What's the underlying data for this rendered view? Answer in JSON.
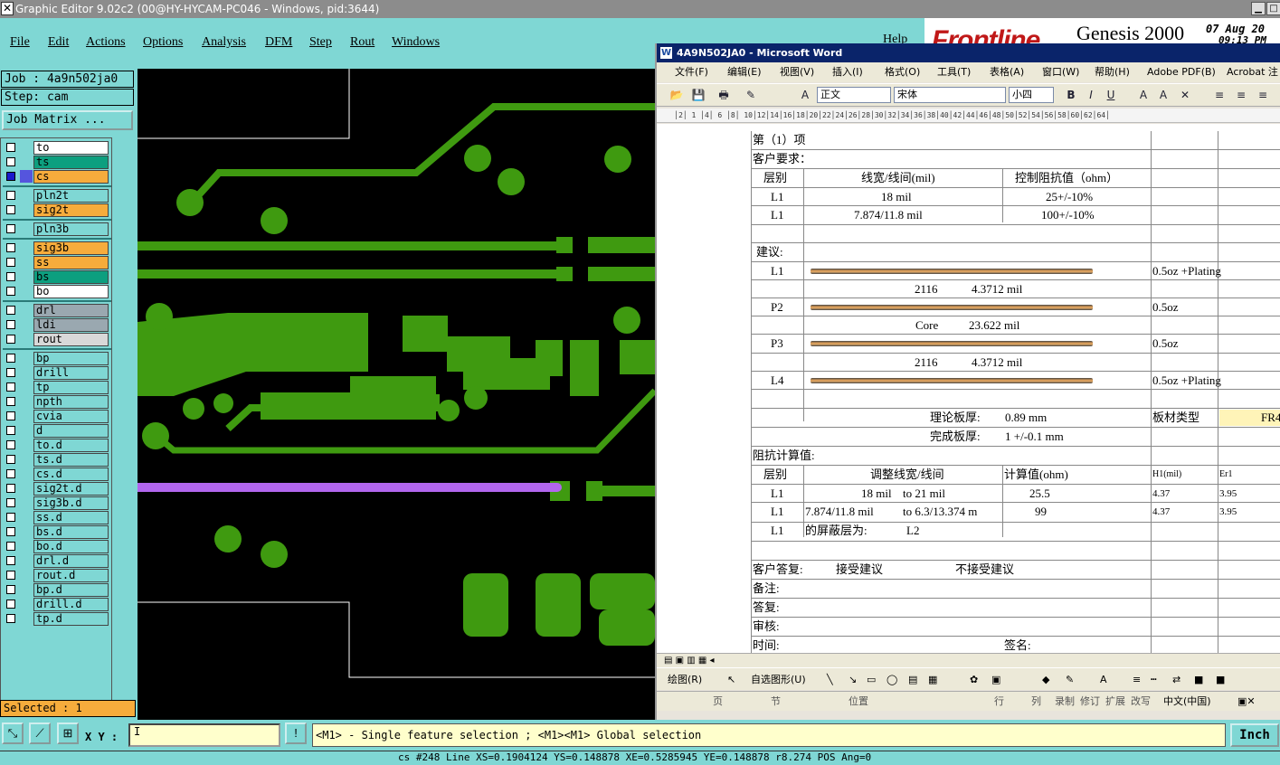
{
  "genesis": {
    "title": "Graphic Editor 9.02c2 (00@HY-HYCAM-PC046 - Windows, pid:3644)",
    "menu": [
      "File",
      "Edit",
      "Actions",
      "Options",
      "Analysis",
      "DFM",
      "Step",
      "Rout",
      "Windows"
    ],
    "help": "Help",
    "logo": {
      "brand": "Frontline",
      "product": "Genesis 2000",
      "date": "07 Aug 20",
      "time": "09:13 PM"
    },
    "job": "Job : 4a9n502ja0",
    "step": "Step: cam",
    "job_matrix": "Job Matrix ...",
    "layers": [
      {
        "name": "to",
        "color": "#ffffff"
      },
      {
        "name": "ts",
        "color": "#0d9f7f"
      },
      {
        "name": "cs",
        "color": "#f6ac3c",
        "selected": true
      },
      {
        "name": "pln2t",
        "color": "#7fd7d4"
      },
      {
        "name": "sig2t",
        "color": "#f6ac3c"
      },
      {
        "name": "pln3b",
        "color": "#7fd7d4"
      },
      {
        "name": "sig3b",
        "color": "#f6ac3c"
      },
      {
        "name": "ss",
        "color": "#f6ac3c"
      },
      {
        "name": "bs",
        "color": "#0d9f7f"
      },
      {
        "name": "bo",
        "color": "#ffffff"
      },
      {
        "name": "drl",
        "color": "#9aa8b0"
      },
      {
        "name": "ldi",
        "color": "#9aa8b0"
      },
      {
        "name": "rout",
        "color": "#d8d8d8"
      },
      {
        "name": "bp",
        "color": "#7fd7d4"
      },
      {
        "name": "drill",
        "color": "#7fd7d4"
      },
      {
        "name": "tp",
        "color": "#7fd7d4"
      },
      {
        "name": "npth",
        "color": "#7fd7d4"
      },
      {
        "name": "cvia",
        "color": "#7fd7d4"
      },
      {
        "name": "d",
        "color": "#7fd7d4"
      },
      {
        "name": "to.d",
        "color": "#7fd7d4"
      },
      {
        "name": "ts.d",
        "color": "#7fd7d4"
      },
      {
        "name": "cs.d",
        "color": "#7fd7d4"
      },
      {
        "name": "sig2t.d",
        "color": "#7fd7d4"
      },
      {
        "name": "sig3b.d",
        "color": "#7fd7d4"
      },
      {
        "name": "ss.d",
        "color": "#7fd7d4"
      },
      {
        "name": "bs.d",
        "color": "#7fd7d4"
      },
      {
        "name": "bo.d",
        "color": "#7fd7d4"
      },
      {
        "name": "drl.d",
        "color": "#7fd7d4"
      },
      {
        "name": "rout.d",
        "color": "#7fd7d4"
      },
      {
        "name": "bp.d",
        "color": "#7fd7d4"
      },
      {
        "name": "drill.d",
        "color": "#7fd7d4"
      },
      {
        "name": "tp.d",
        "color": "#7fd7d4"
      }
    ],
    "selected": "Selected : 1",
    "xy_label": "X Y :",
    "xy_value": "I",
    "message": "<M1> - Single feature selection ; <M1><M1> Global selection",
    "units": "Inch",
    "status": "cs #248 Line XS=0.1904124 YS=0.148878 XE=0.5285945 YE=0.148878 r8.274 POS Ang=0",
    "colors": {
      "panel": "#7fd7d4",
      "feature": "#3f9a10",
      "highlight": "#b266ee"
    }
  },
  "word": {
    "title": "4A9N502JA0 - Microsoft Word",
    "menu": [
      "文件(F)",
      "编辑(E)",
      "视图(V)",
      "插入(I)",
      "格式(O)",
      "工具(T)",
      "表格(A)",
      "窗口(W)",
      "帮助(H)",
      "Adobe PDF(B)",
      "Acrobat 注"
    ],
    "style": "正文",
    "font": "宋体",
    "size": "小四",
    "doc": {
      "item": "第（1）项",
      "customer_req": "客户要求：",
      "h_layer": "层别",
      "h_width": "线宽/线间(mil)",
      "h_imp": "控制阻抗值（ohm）",
      "r1_layer": "L1",
      "r1_width": "18 mil",
      "r1_imp": "25+/-10%",
      "r2_layer": "L1",
      "r2_width": "7.874/11.8 mil",
      "r2_imp": "100+/-10%",
      "suggest": "建议:",
      "s_l1": "L1",
      "s_l1_cu": "0.5oz +Plating",
      "s_pp1": "2116",
      "s_pp1_t": "4.3712 mil",
      "s_p2": "P2",
      "s_p2_cu": "0.5oz",
      "s_core": "Core",
      "s_core_t": "23.622 mil",
      "s_p3": "P3",
      "s_p3_cu": "0.5oz",
      "s_pp2": "2116",
      "s_pp2_t": "4.3712 mil",
      "s_l4": "L4",
      "s_l4_cu": "0.5oz +Plating",
      "theory": "理论板厚:",
      "theory_v": "0.89 mm",
      "material": "板材类型",
      "material_v": "FR4",
      "finish": "完成板厚:",
      "finish_v": "1 +/-0.1 mm",
      "calc": "阻抗计算值:",
      "c_layer": "层别",
      "c_adj": "调整线宽/线间",
      "c_val": "计算值(ohm)",
      "c_h1": "H1(mil)",
      "c_er": "Er1",
      "c1_layer": "L1",
      "c1_from": "18 mil",
      "c1_to": "to  21 mil",
      "c1_val": "25.5",
      "c1_h1": "4.37",
      "c1_er": "3.95",
      "c2_layer": "L1",
      "c2_from": "7.874/11.8 mil",
      "c2_to": "to  6.3/13.374 m",
      "c2_val": "99",
      "c2_h1": "4.37",
      "c2_er": "3.95",
      "c3_layer": "L1",
      "c3_shield": "的屏蔽层为:",
      "c3_ref": "L2",
      "reply": "客户答复:",
      "accept": "接受建议",
      "reject": "不接受建议",
      "remark": "备注:",
      "answer": "答复:",
      "review": "审核:",
      "time": "时间:",
      "sign": "签名:"
    },
    "draw_label": "绘图(R)",
    "autoshape": "自选图形(U)",
    "status": [
      "页",
      "节",
      "位置",
      "行",
      "列",
      "录制",
      "修订",
      "扩展",
      "改写",
      "中文(中国)"
    ]
  }
}
